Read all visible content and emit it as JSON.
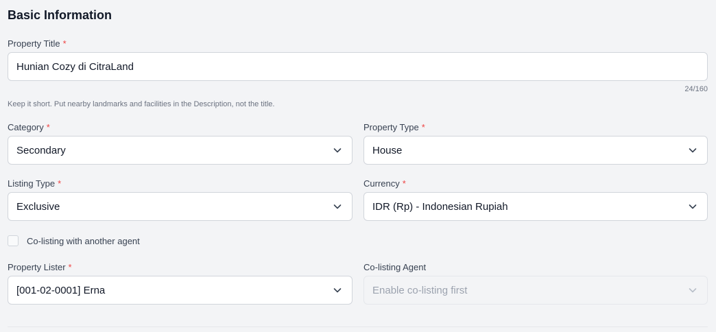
{
  "section": {
    "title": "Basic Information"
  },
  "property_title": {
    "label": "Property Title",
    "required_mark": "*",
    "value": "Hunian Cozy di CitraLand",
    "counter": "24/160",
    "hint": "Keep it short. Put nearby landmarks and facilities in the Description, not the title."
  },
  "category": {
    "label": "Category",
    "required_mark": "*",
    "value": "Secondary"
  },
  "property_type": {
    "label": "Property Type",
    "required_mark": "*",
    "value": "House"
  },
  "listing_type": {
    "label": "Listing Type",
    "required_mark": "*",
    "value": "Exclusive"
  },
  "currency": {
    "label": "Currency",
    "required_mark": "*",
    "value": "IDR (Rp) - Indonesian Rupiah"
  },
  "co_listing": {
    "label": "Co-listing with another agent",
    "checked": false
  },
  "property_lister": {
    "label": "Property Lister",
    "required_mark": "*",
    "value": "[001-02-0001] Erna"
  },
  "co_listing_agent": {
    "label": "Co-listing Agent",
    "placeholder": "Enable co-listing first"
  },
  "colors": {
    "required": "#ef4444",
    "background": "#f3f4f6",
    "border": "#d1d5db"
  }
}
